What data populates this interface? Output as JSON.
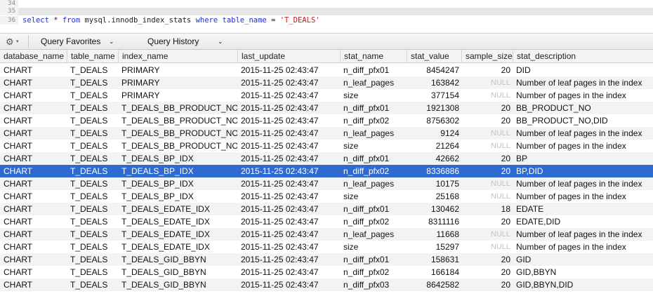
{
  "editor": {
    "lines": [
      {
        "num": "34",
        "tokens": []
      },
      {
        "num": "35",
        "tokens": []
      },
      {
        "num": "36",
        "tokens": [
          {
            "t": "select",
            "c": "kw"
          },
          {
            "t": " * ",
            "c": ""
          },
          {
            "t": "from",
            "c": "kw"
          },
          {
            "t": " mysql.innodb_index_stats ",
            "c": ""
          },
          {
            "t": "where",
            "c": "kw"
          },
          {
            "t": " ",
            "c": ""
          },
          {
            "t": "table_name",
            "c": "kw"
          },
          {
            "t": " = ",
            "c": ""
          },
          {
            "t": "'T_DEALS'",
            "c": "str"
          }
        ]
      }
    ]
  },
  "toolbar": {
    "gear_icon": "gear-icon",
    "query_favorites": "Query Favorites",
    "query_history": "Query History"
  },
  "grid": {
    "columns": [
      "database_name",
      "table_name",
      "index_name",
      "last_update",
      "stat_name",
      "stat_value",
      "sample_size",
      "stat_description"
    ],
    "selected_row": 8,
    "rows": [
      [
        "CHART",
        "T_DEALS",
        "PRIMARY",
        "2015-11-25 02:43:47",
        "n_diff_pfx01",
        "8454247",
        "20",
        "DID"
      ],
      [
        "CHART",
        "T_DEALS",
        "PRIMARY",
        "2015-11-25 02:43:47",
        "n_leaf_pages",
        "163842",
        "NULL",
        "Number of leaf pages in the index"
      ],
      [
        "CHART",
        "T_DEALS",
        "PRIMARY",
        "2015-11-25 02:43:47",
        "size",
        "377154",
        "NULL",
        "Number of pages in the index"
      ],
      [
        "CHART",
        "T_DEALS",
        "T_DEALS_BB_PRODUCT_NO",
        "2015-11-25 02:43:47",
        "n_diff_pfx01",
        "1921308",
        "20",
        "BB_PRODUCT_NO"
      ],
      [
        "CHART",
        "T_DEALS",
        "T_DEALS_BB_PRODUCT_NO",
        "2015-11-25 02:43:47",
        "n_diff_pfx02",
        "8756302",
        "20",
        "BB_PRODUCT_NO,DID"
      ],
      [
        "CHART",
        "T_DEALS",
        "T_DEALS_BB_PRODUCT_NO",
        "2015-11-25 02:43:47",
        "n_leaf_pages",
        "9124",
        "NULL",
        "Number of leaf pages in the index"
      ],
      [
        "CHART",
        "T_DEALS",
        "T_DEALS_BB_PRODUCT_NO",
        "2015-11-25 02:43:47",
        "size",
        "21264",
        "NULL",
        "Number of pages in the index"
      ],
      [
        "CHART",
        "T_DEALS",
        "T_DEALS_BP_IDX",
        "2015-11-25 02:43:47",
        "n_diff_pfx01",
        "42662",
        "20",
        "BP"
      ],
      [
        "CHART",
        "T_DEALS",
        "T_DEALS_BP_IDX",
        "2015-11-25 02:43:47",
        "n_diff_pfx02",
        "8336886",
        "20",
        "BP,DID"
      ],
      [
        "CHART",
        "T_DEALS",
        "T_DEALS_BP_IDX",
        "2015-11-25 02:43:47",
        "n_leaf_pages",
        "10175",
        "NULL",
        "Number of leaf pages in the index"
      ],
      [
        "CHART",
        "T_DEALS",
        "T_DEALS_BP_IDX",
        "2015-11-25 02:43:47",
        "size",
        "25168",
        "NULL",
        "Number of pages in the index"
      ],
      [
        "CHART",
        "T_DEALS",
        "T_DEALS_EDATE_IDX",
        "2015-11-25 02:43:47",
        "n_diff_pfx01",
        "130462",
        "18",
        "EDATE"
      ],
      [
        "CHART",
        "T_DEALS",
        "T_DEALS_EDATE_IDX",
        "2015-11-25 02:43:47",
        "n_diff_pfx02",
        "8311116",
        "20",
        "EDATE,DID"
      ],
      [
        "CHART",
        "T_DEALS",
        "T_DEALS_EDATE_IDX",
        "2015-11-25 02:43:47",
        "n_leaf_pages",
        "11668",
        "NULL",
        "Number of leaf pages in the index"
      ],
      [
        "CHART",
        "T_DEALS",
        "T_DEALS_EDATE_IDX",
        "2015-11-25 02:43:47",
        "size",
        "15297",
        "NULL",
        "Number of pages in the index"
      ],
      [
        "CHART",
        "T_DEALS",
        "T_DEALS_GID_BBYN",
        "2015-11-25 02:43:47",
        "n_diff_pfx01",
        "158631",
        "20",
        "GID"
      ],
      [
        "CHART",
        "T_DEALS",
        "T_DEALS_GID_BBYN",
        "2015-11-25 02:43:47",
        "n_diff_pfx02",
        "166184",
        "20",
        "GID,BBYN"
      ],
      [
        "CHART",
        "T_DEALS",
        "T_DEALS_GID_BBYN",
        "2015-11-25 02:43:47",
        "n_diff_pfx03",
        "8642582",
        "20",
        "GID,BBYN,DID"
      ]
    ]
  }
}
